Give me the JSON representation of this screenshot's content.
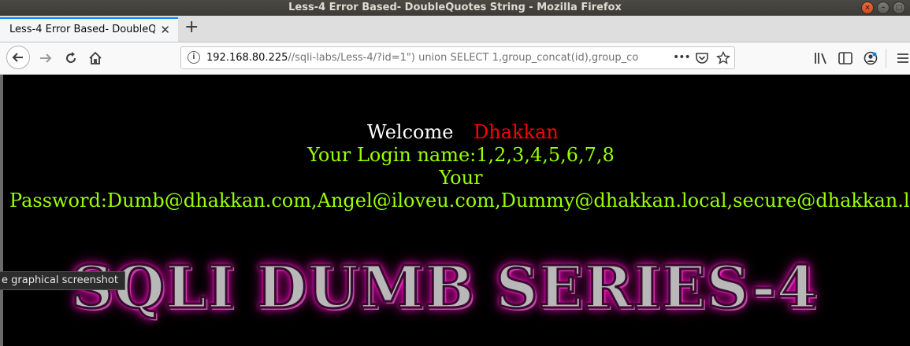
{
  "window": {
    "title": "Less-4 Error Based- DoubleQuotes String - Mozilla Firefox"
  },
  "tab": {
    "label": "Less-4 Error Based- DoubleQ",
    "close": "✕"
  },
  "newtab": {
    "label": "+"
  },
  "url": {
    "host": "192.168.80.225",
    "path": "//sqli-labs/Less-4/?id=1\") union SELECT 1,group_concat(id),group_co"
  },
  "page": {
    "welcome": "Welcome",
    "name": "Dhakkan",
    "login": "Your Login name:1,2,3,4,5,6,7,8",
    "your": "Your",
    "password": "Password:Dumb@dhakkan.com,Angel@iloveu.com,Dummy@dhakkan.local,secure@dhakkan.lo",
    "banner": "SQLI DUMB SERIES-4"
  },
  "tooltip": {
    "text": "e graphical screenshot"
  },
  "colors": {
    "accent": "#0a84ff",
    "welcome": "#ffffff",
    "name": "#ff0000",
    "green": "#99ff00",
    "banner_glow": "#ff00cc"
  },
  "icons": [
    "back-arrow-icon",
    "forward-arrow-icon",
    "reload-icon",
    "home-icon",
    "info-icon",
    "more-icon",
    "pocket-icon",
    "bookmark-star-icon",
    "library-icon",
    "sidebar-icon",
    "account-icon",
    "menu-icon"
  ]
}
